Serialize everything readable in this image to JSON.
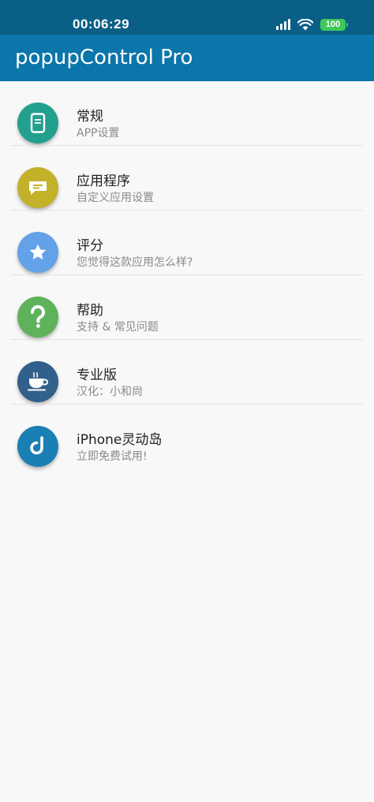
{
  "status_bar": {
    "time": "00:06:29",
    "battery": "100",
    "icons": [
      "signal-icon",
      "wifi-icon",
      "battery-icon"
    ],
    "battery_color": "#3ec85a"
  },
  "app_bar": {
    "title": "popupControl Pro",
    "color": "#0b76aa"
  },
  "menu": {
    "items": [
      {
        "title": "常规",
        "subtitle": "APP设置",
        "icon": "phone-icon",
        "color": "#23a08d"
      },
      {
        "title": "应用程序",
        "subtitle": "自定义应用设置",
        "icon": "message-icon",
        "color": "#c3b12a"
      },
      {
        "title": "评分",
        "subtitle": "您觉得这款应用怎么样?",
        "icon": "star-icon",
        "color": "#63a2e8"
      },
      {
        "title": "帮助",
        "subtitle": "支持 & 常见问题",
        "icon": "question-icon",
        "color": "#5fb25a"
      },
      {
        "title": "专业版",
        "subtitle": "汉化：小和尙",
        "icon": "coffee-cup-icon",
        "color": "#31608a"
      },
      {
        "title": "iPhone灵动岛",
        "subtitle": "立即免费试用!",
        "icon": "dynamic-island-logo-icon",
        "color": "#1a7fb3"
      }
    ]
  }
}
